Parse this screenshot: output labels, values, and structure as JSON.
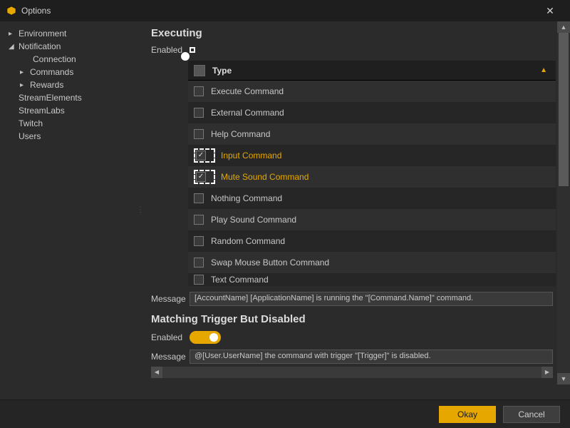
{
  "window": {
    "title": "Options"
  },
  "sidebar": {
    "items": [
      {
        "label": "Environment",
        "caret": "▸",
        "indent": 0
      },
      {
        "label": "Notification",
        "caret": "◢",
        "indent": 0
      },
      {
        "label": "Connection",
        "caret": "",
        "indent": 2
      },
      {
        "label": "Commands",
        "caret": "▸",
        "indent": 1
      },
      {
        "label": "Rewards",
        "caret": "▸",
        "indent": 1
      },
      {
        "label": "StreamElements",
        "caret": "",
        "indent": 0
      },
      {
        "label": "StreamLabs",
        "caret": "",
        "indent": 0
      },
      {
        "label": "Twitch",
        "caret": "",
        "indent": 0
      },
      {
        "label": "Users",
        "caret": "",
        "indent": 0
      }
    ]
  },
  "panel": {
    "executing": {
      "heading": "Executing",
      "enabled_label": "Enabled",
      "enabled": true,
      "grid_header": "Type",
      "rows": [
        {
          "label": "Execute Command",
          "checked": false,
          "hl": false
        },
        {
          "label": "External Command",
          "checked": false,
          "hl": false
        },
        {
          "label": "Help Command",
          "checked": false,
          "hl": false
        },
        {
          "label": "Input Command",
          "checked": true,
          "hl": true
        },
        {
          "label": "Mute Sound Command",
          "checked": true,
          "hl": true
        },
        {
          "label": "Nothing Command",
          "checked": false,
          "hl": false
        },
        {
          "label": "Play Sound Command",
          "checked": false,
          "hl": false
        },
        {
          "label": "Random Command",
          "checked": false,
          "hl": false
        },
        {
          "label": "Swap Mouse Button Command",
          "checked": false,
          "hl": false
        },
        {
          "label": "Text Command",
          "checked": false,
          "hl": false
        }
      ],
      "message_label": "Message",
      "message_value": "[AccountName] [ApplicationName] is running the \"[Command.Name]\" command."
    },
    "disabled": {
      "heading": "Matching Trigger But Disabled",
      "enabled_label": "Enabled",
      "enabled": true,
      "message_label": "Message",
      "message_value": "@[User.UserName] the command with trigger \"[Trigger]\" is disabled."
    }
  },
  "footer": {
    "ok": "Okay",
    "cancel": "Cancel"
  }
}
